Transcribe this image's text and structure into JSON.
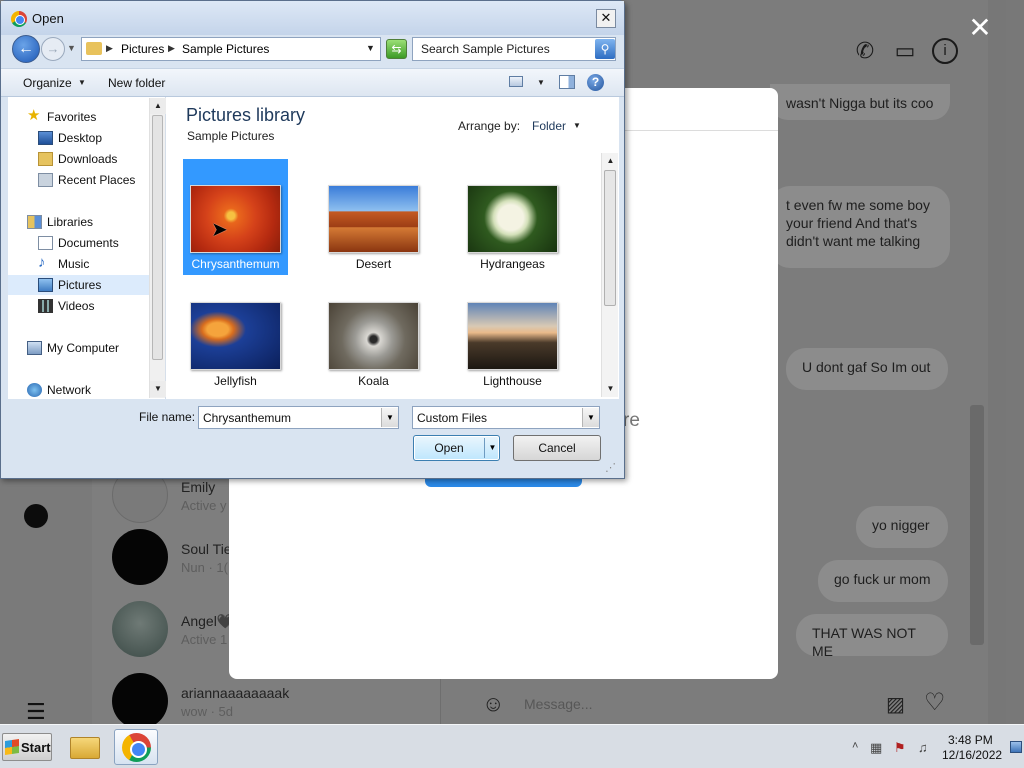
{
  "dialog": {
    "title": "Open",
    "close_glyph": "✕",
    "breadcrumb": [
      "Pictures",
      "Sample Pictures"
    ],
    "search_placeholder": "Search Sample Pictures",
    "toolbar": {
      "organize": "Organize",
      "new_folder": "New folder"
    },
    "nav": {
      "favorites": "Favorites",
      "desktop": "Desktop",
      "downloads": "Downloads",
      "recent_places": "Recent Places",
      "libraries": "Libraries",
      "documents": "Documents",
      "music": "Music",
      "pictures": "Pictures",
      "videos": "Videos",
      "my_computer": "My Computer",
      "network": "Network"
    },
    "library": {
      "title": "Pictures library",
      "subtitle": "Sample Pictures",
      "arrange_label": "Arrange by:",
      "arrange_value": "Folder"
    },
    "files": [
      {
        "name": "Chrysanthemum",
        "selected": true
      },
      {
        "name": "Desert",
        "selected": false
      },
      {
        "name": "Hydrangeas",
        "selected": false
      },
      {
        "name": "Jellyfish",
        "selected": false
      },
      {
        "name": "Koala",
        "selected": false
      },
      {
        "name": "Lighthouse",
        "selected": false
      }
    ],
    "file_name_label": "File name:",
    "file_name_value": "Chrysanthemum",
    "file_type_value": "Custom Files",
    "open_label": "Open",
    "cancel_label": "Cancel"
  },
  "background": {
    "messages": [
      "wasn't Nigga but its coo",
      "t even fw me some boy\nyour friend And that's\ndidn't want me talking",
      "U dont gaf So Im out",
      "yo nigger",
      "go fuck ur mom",
      "THAT WAS NOT ME"
    ],
    "conversations": [
      {
        "name": "Emily",
        "sub": "Active y"
      },
      {
        "name": "Soul Tie",
        "sub": "Nun · 1("
      },
      {
        "name": "Angel🖤",
        "sub": "Active 1"
      },
      {
        "name": "ariannaaaaaaaak",
        "sub": "wow · 5d"
      }
    ],
    "modal_fragment": "re",
    "message_placeholder": "Message...",
    "close_overlay_glyph": "✕"
  },
  "taskbar": {
    "start_label": "Start",
    "time": "3:48 PM",
    "date": "12/16/2022"
  },
  "colors": {
    "selection": "#3399ff",
    "dialog_frame": "#d9e4f1",
    "library_title": "#1e395b",
    "taskbar": "#d8dde4"
  }
}
